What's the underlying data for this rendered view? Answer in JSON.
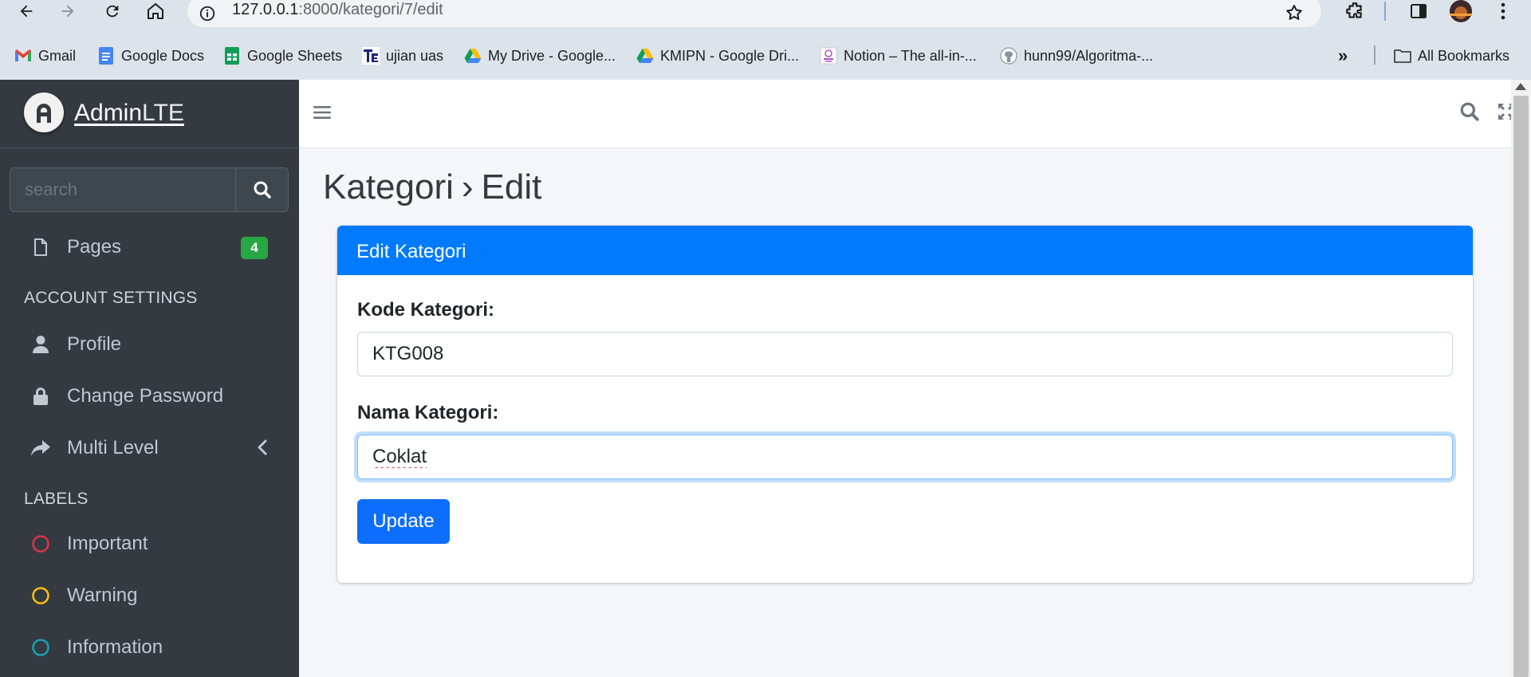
{
  "browser": {
    "url_host": "127.0.0.1",
    "url_rest": ":8000/kategori/7/edit",
    "bookmarks": [
      {
        "label": "Gmail",
        "icon": "gmail-icon"
      },
      {
        "label": "Google Docs",
        "icon": "google-docs-icon"
      },
      {
        "label": "Google Sheets",
        "icon": "google-sheets-icon"
      },
      {
        "label": "ujian uas",
        "icon": "te-icon"
      },
      {
        "label": "My Drive - Google...",
        "icon": "google-drive-icon"
      },
      {
        "label": "KMIPN - Google Dri...",
        "icon": "google-drive-icon"
      },
      {
        "label": "Notion – The all-in-...",
        "icon": "notion-icon"
      },
      {
        "label": "hunn99/Algoritma-...",
        "icon": "github-icon"
      }
    ],
    "more_bookmarks": "»",
    "all_bookmarks": "All Bookmarks"
  },
  "sidebar": {
    "brand_bold": "Admin",
    "brand_light": "LTE",
    "search_placeholder": "search",
    "pages_label": "Pages",
    "pages_badge": "4",
    "account_header": "ACCOUNT SETTINGS",
    "profile_label": "Profile",
    "change_password_label": "Change Password",
    "multi_level_label": "Multi Level",
    "labels_header": "LABELS",
    "important_label": "Important",
    "warning_label": "Warning",
    "information_label": "Information"
  },
  "colors": {
    "primary": "#007bff",
    "button": "#0d6efd",
    "badge": "#28a745",
    "important": "#dc3545",
    "warning": "#ffc107",
    "information": "#17a2b8",
    "sidebar_bg": "#343a40"
  },
  "content": {
    "title_main": "Kategori",
    "title_sep": "›",
    "title_sub": "Edit",
    "card_title": "Edit Kategori",
    "kode_label": "Kode Kategori:",
    "kode_value": "KTG008",
    "nama_label": "Nama Kategori:",
    "nama_value": "Coklat",
    "update_label": "Update"
  }
}
